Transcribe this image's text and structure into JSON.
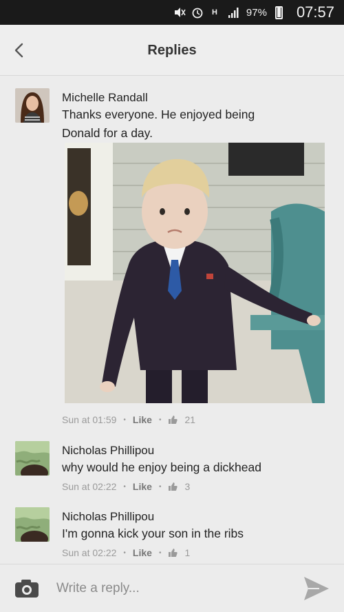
{
  "status": {
    "battery": "97%",
    "time": "07:57"
  },
  "header": {
    "title": "Replies"
  },
  "comments": [
    {
      "name": "Michelle Randall",
      "text_line1": "Thanks everyone. He enjoyed being",
      "text_line2": "Donald for a day.",
      "time": "Sun at 01:59",
      "like_label": "Like",
      "likes": "21"
    },
    {
      "name": "Nicholas Phillipou",
      "text_line1": "why would he enjoy being a dickhead",
      "time": "Sun at 02:22",
      "like_label": "Like",
      "likes": "3"
    },
    {
      "name": "Nicholas Phillipou",
      "text_line1": "I'm gonna kick your son in the ribs",
      "time": "Sun at 02:22",
      "like_label": "Like",
      "likes": "1"
    }
  ],
  "reply": {
    "placeholder": "Write a reply..."
  },
  "colors": {
    "background": "#ececec",
    "status_bar": "#1a1a1a",
    "send_icon": "#a8a8a8"
  },
  "icons": [
    "back-arrow-icon",
    "camera-icon",
    "send-icon",
    "like-thumb-icon",
    "signal-icon",
    "alarm-icon",
    "battery-icon"
  ]
}
